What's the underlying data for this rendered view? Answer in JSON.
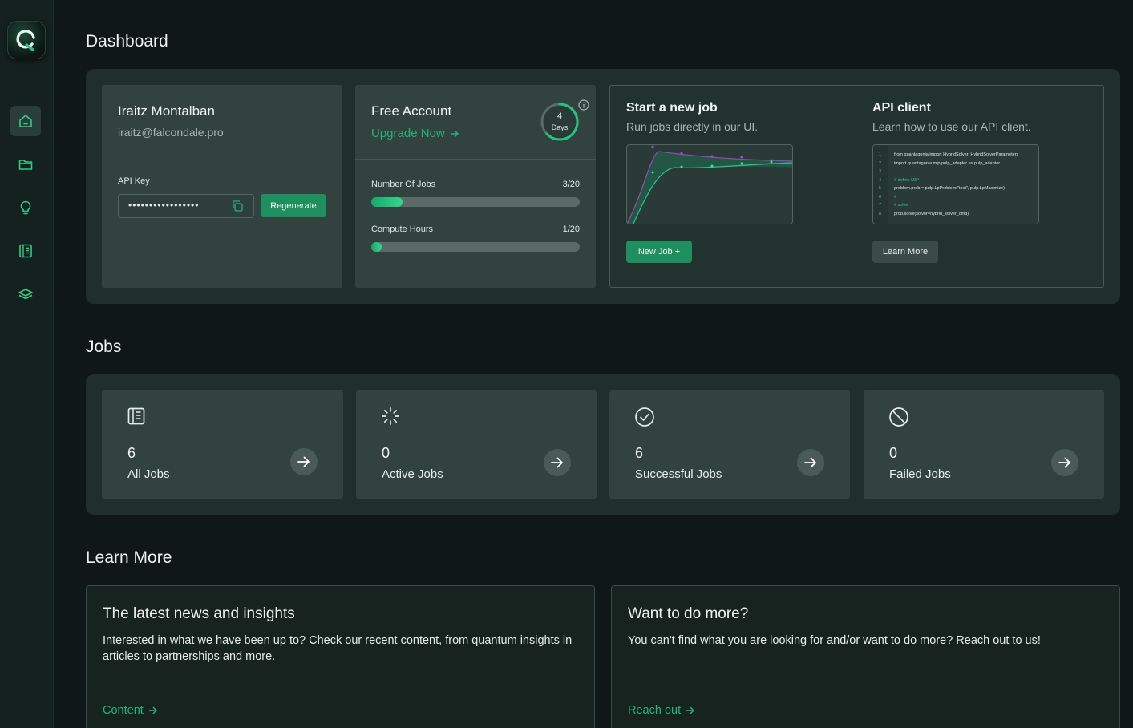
{
  "nav": {
    "items": [
      {
        "name": "home-icon",
        "active": true
      },
      {
        "name": "folder-icon",
        "active": false
      },
      {
        "name": "lightbulb-icon",
        "active": false
      },
      {
        "name": "book-icon",
        "active": false
      },
      {
        "name": "layers-icon",
        "active": false
      }
    ]
  },
  "dashboard": {
    "title": "Dashboard",
    "user": {
      "name": "Iraitz Montalban",
      "email": "iraitz@falcondale.pro",
      "api_key_label": "API Key",
      "api_key_value": "•••••••••••••••••",
      "regenerate_label": "Regenerate"
    },
    "account": {
      "plan": "Free Account",
      "upgrade_label": "Upgrade Now",
      "days_value": "4",
      "days_label": "Days",
      "jobs_label": "Number Of Jobs",
      "jobs_value": "3/20",
      "jobs_fraction": 0.15,
      "hours_label": "Compute Hours",
      "hours_value": "1/20",
      "hours_fraction": 0.05
    },
    "new_job": {
      "title": "Start a new job",
      "subtitle": "Run jobs directly in our UI.",
      "button_label": "New Job +"
    },
    "api_client": {
      "title": "API client",
      "subtitle": "Learn how to use our API client.",
      "button_label": "Learn More",
      "code_lines": [
        {
          "num": "1",
          "text": "from quantagonia.import HybridSolver, HybridSolverParameters"
        },
        {
          "num": "2",
          "text": "import quantagonia.mip.pulp_adapter as pulp_adapter"
        },
        {
          "num": "3",
          "text": ""
        },
        {
          "num": "4",
          "text": "# define MIP"
        },
        {
          "num": "5",
          "text": "problem.prob = pulp.LpProblem(\"test\", pulp.LpMaximize)"
        },
        {
          "num": "6",
          "text": "#"
        },
        {
          "num": "7",
          "text": "# solve"
        },
        {
          "num": "8",
          "text": "prob.solve(solver=hybrid_solver_cmd)"
        }
      ]
    }
  },
  "jobs": {
    "title": "Jobs",
    "cards": [
      {
        "count": "6",
        "label": "All Jobs",
        "icon": "list-icon"
      },
      {
        "count": "0",
        "label": "Active Jobs",
        "icon": "loader-icon"
      },
      {
        "count": "6",
        "label": "Successful Jobs",
        "icon": "check-circle-icon"
      },
      {
        "count": "0",
        "label": "Failed Jobs",
        "icon": "ban-icon"
      }
    ]
  },
  "learn_more": {
    "title": "Learn More",
    "news": {
      "title": "The latest news and insights",
      "body": "Interested in what we have been up to? Check our recent content, from quantum insights in articles to partnerships and more.",
      "link_label": "Content"
    },
    "more": {
      "title": "Want to do more?",
      "body": "You can't find what you are looking for and/or want to do more? Reach out to us!",
      "link_label": "Reach out"
    }
  },
  "colors": {
    "accent": "#22b47a",
    "background": "#0f1816",
    "panel": "#1f2f2b",
    "card": "#32433f"
  }
}
